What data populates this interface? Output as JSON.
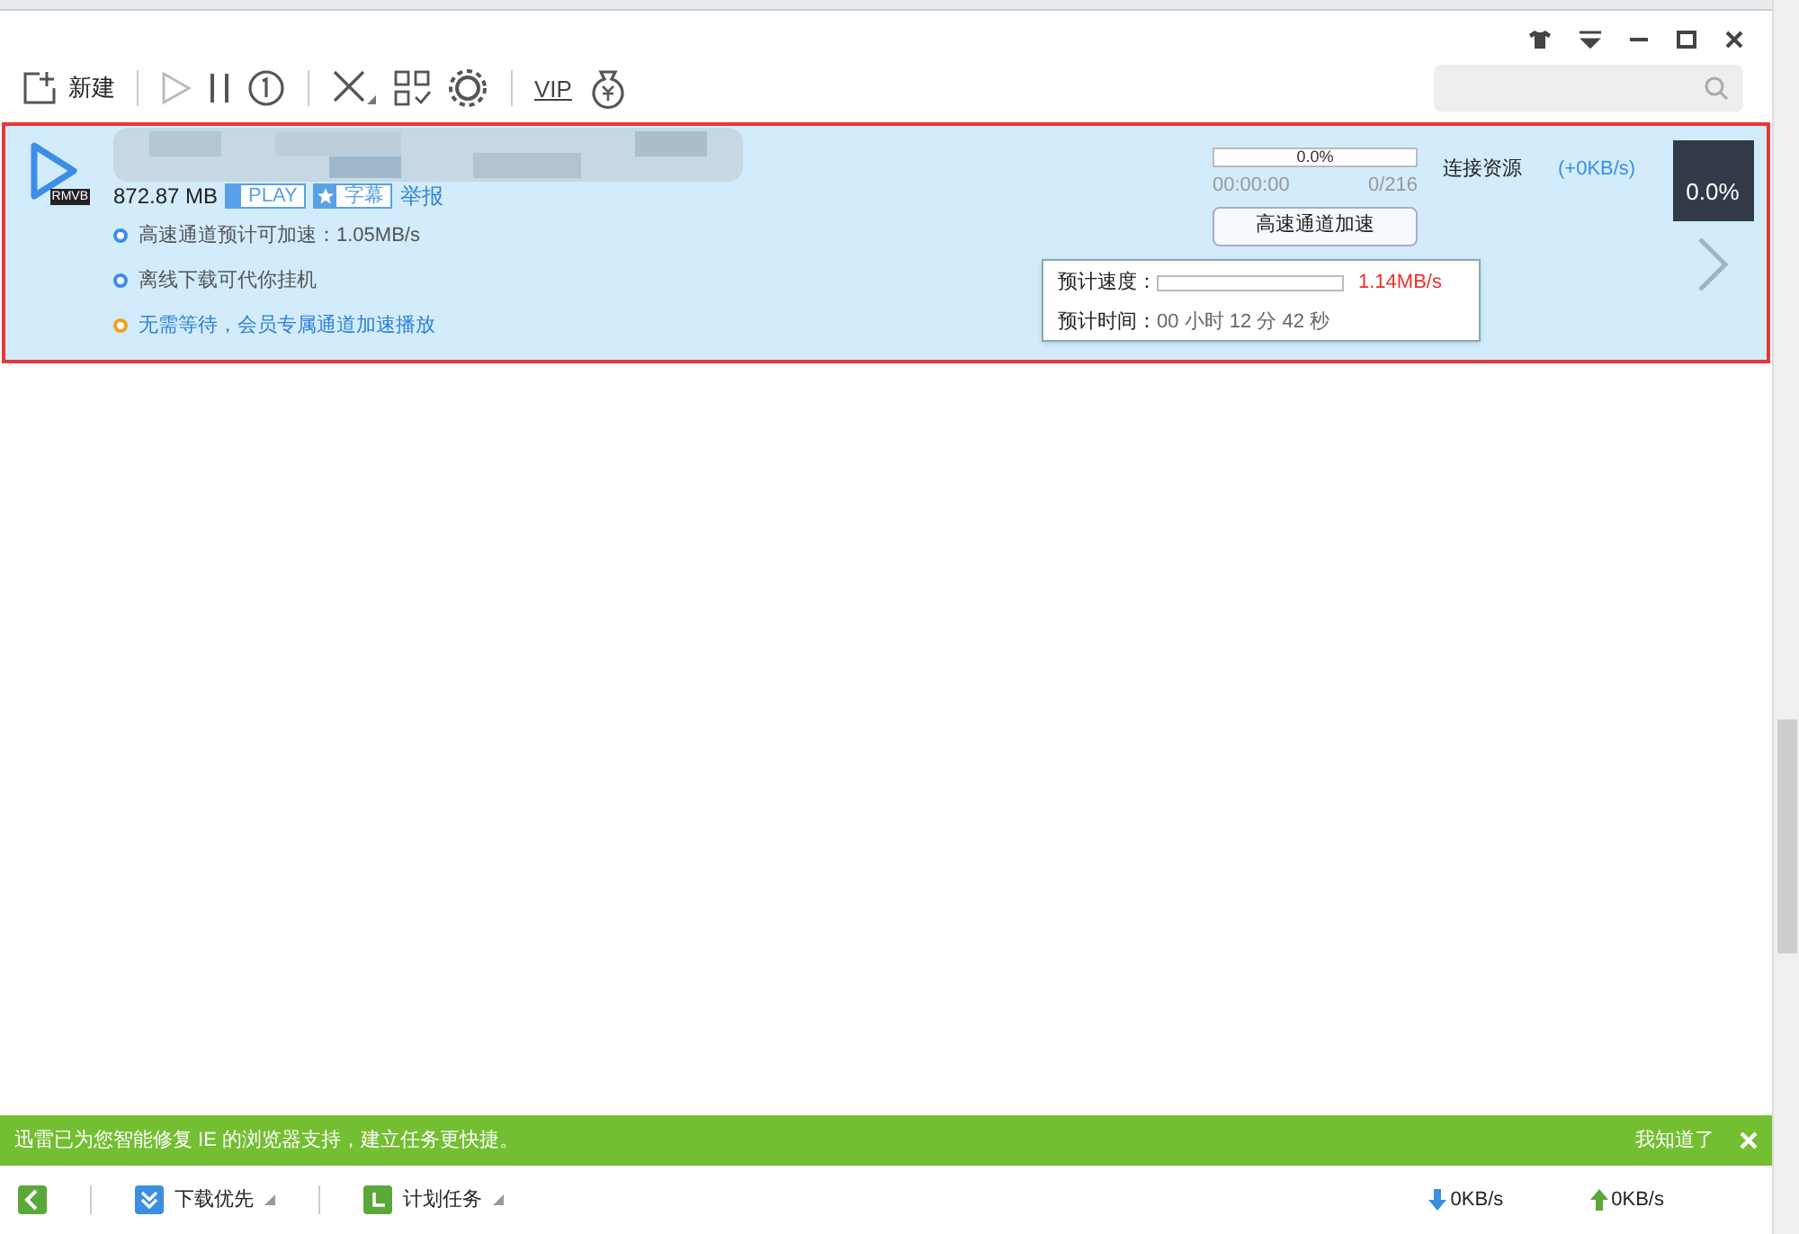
{
  "toolbar": {
    "new_label": "新建",
    "vip_label": "VIP"
  },
  "task": {
    "size": "872.87 MB",
    "play_badge": "PLAY",
    "subtitle_badge": "字幕",
    "report_link": "举报",
    "format_label": "RMVB",
    "tips": [
      {
        "text": "高速通道预计可加速：1.05MB/s",
        "color": "#3b8ee8",
        "link": false
      },
      {
        "text": "离线下载可代你挂机",
        "color": "#3b8ee8",
        "link": false
      },
      {
        "text": "无需等待，会员专属通道加速播放",
        "color": "#f0a020",
        "link": true
      }
    ],
    "progress": {
      "label": "0.0%",
      "level": 0
    },
    "elapsed": "00:00:00",
    "sources": "0/216",
    "accel_button": "高速通道加速",
    "status": "连接资源",
    "speed": "(+0KB/s)",
    "percent": "0.0%",
    "tooltip": {
      "speed_label": "预计速度：",
      "level": 0,
      "speed_value": "1.14MB/s",
      "time_label": "预计时间：",
      "time_value": "00 小时 12 分 42 秒"
    }
  },
  "notice": {
    "text": "迅雷已为您智能修复 IE 的浏览器支持，建立任务更快捷。",
    "dismiss": "我知道了"
  },
  "status_bar": {
    "priority": "下载优先",
    "schedule": "计划任务",
    "down_speed": "0KB/s",
    "up_speed": "0KB/s"
  }
}
